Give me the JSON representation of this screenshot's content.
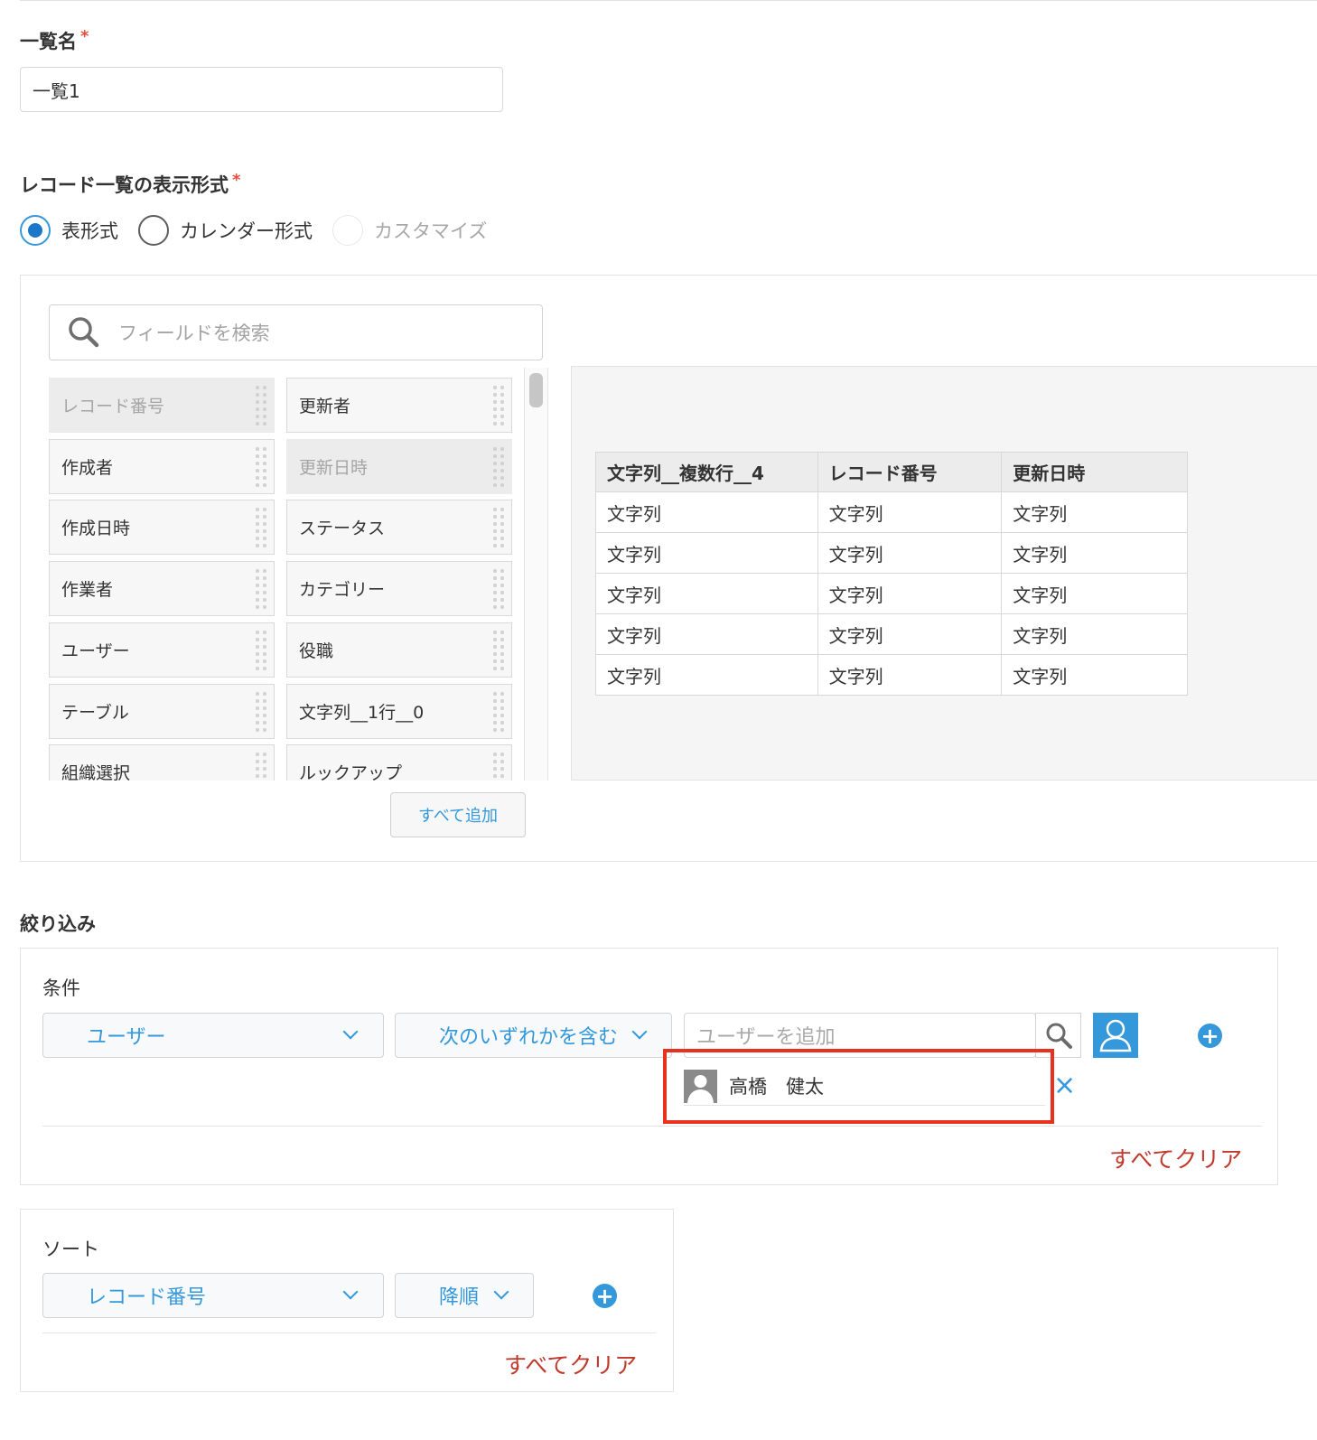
{
  "list_name": {
    "label": "一覧名",
    "required_mark": "*",
    "value": "一覧1"
  },
  "display_format": {
    "label": "レコード一覧の表示形式",
    "required_mark": "*",
    "options": [
      "表形式",
      "カレンダー形式",
      "カスタマイズ"
    ],
    "selected": "表形式"
  },
  "field_panel": {
    "search_placeholder": "フィールドを検索",
    "fields": [
      {
        "label": "レコード番号",
        "used": true
      },
      {
        "label": "更新者",
        "used": false
      },
      {
        "label": "作成者",
        "used": false
      },
      {
        "label": "更新日時",
        "used": true
      },
      {
        "label": "作成日時",
        "used": false
      },
      {
        "label": "ステータス",
        "used": false
      },
      {
        "label": "作業者",
        "used": false
      },
      {
        "label": "カテゴリー",
        "used": false
      },
      {
        "label": "ユーザー",
        "used": false
      },
      {
        "label": "役職",
        "used": false
      },
      {
        "label": "テーブル",
        "used": false
      },
      {
        "label": "文字列__1行__0",
        "used": false
      },
      {
        "label": "組織選択",
        "used": false
      },
      {
        "label": "ルックアップ",
        "used": false
      }
    ],
    "add_all_label": "すべて追加"
  },
  "preview_table": {
    "headers": [
      "文字列__複数行__4",
      "レコード番号",
      "更新日時"
    ],
    "rows": [
      [
        "文字列",
        "文字列",
        "文字列"
      ],
      [
        "文字列",
        "文字列",
        "文字列"
      ],
      [
        "文字列",
        "文字列",
        "文字列"
      ],
      [
        "文字列",
        "文字列",
        "文字列"
      ],
      [
        "文字列",
        "文字列",
        "文字列"
      ]
    ]
  },
  "filter": {
    "section_label": "絞り込み",
    "conditions_label": "条件",
    "field_select": "ユーザー",
    "operator_select": "次のいずれかを含む",
    "user_input_placeholder": "ユーザーを追加",
    "selected_user": "高橋　健太",
    "clear_all": "すべてクリア",
    "highlight_color": "#e8321e"
  },
  "sort": {
    "label": "ソート",
    "field_select": "レコード番号",
    "order_select": "降順",
    "clear_all": "すべてクリア"
  },
  "colors": {
    "accent": "#3498db",
    "danger_link": "#c0392b",
    "required": "#e74c3c"
  }
}
